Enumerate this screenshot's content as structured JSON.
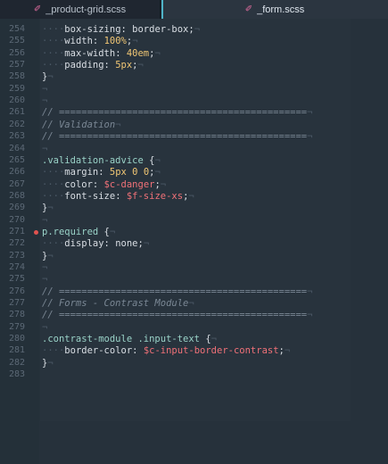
{
  "tabs": [
    {
      "label": "_product-grid.scss",
      "icon": "sass-icon",
      "active": false
    },
    {
      "label": "_form.scss",
      "icon": "sass-icon",
      "active": true
    }
  ],
  "colors": {
    "background": "#26303b",
    "gutter": "#243039",
    "comment": "#7a8794",
    "number": "#f0c674",
    "variable": "#f07178",
    "selector": "#9ad3c8",
    "breakpoint": "#e0534f",
    "active_tab_accent": "#4fb3c7"
  },
  "lines": [
    {
      "n": "254",
      "segs": [
        [
          "ws",
          "····"
        ],
        [
          "prop",
          "box-sizing: border-box;"
        ],
        [
          "ws",
          "¬"
        ]
      ]
    },
    {
      "n": "255",
      "segs": [
        [
          "ws",
          "····"
        ],
        [
          "prop",
          "width: "
        ],
        [
          "num",
          "100%"
        ],
        [
          "pn",
          ";"
        ],
        [
          "ws",
          "¬"
        ]
      ]
    },
    {
      "n": "256",
      "segs": [
        [
          "ws",
          "····"
        ],
        [
          "prop",
          "max-width: "
        ],
        [
          "num",
          "40em"
        ],
        [
          "pn",
          ";"
        ],
        [
          "ws",
          "¬"
        ]
      ]
    },
    {
      "n": "257",
      "segs": [
        [
          "ws",
          "····"
        ],
        [
          "prop",
          "padding: "
        ],
        [
          "num",
          "5px"
        ],
        [
          "pn",
          ";"
        ],
        [
          "ws",
          "¬"
        ]
      ]
    },
    {
      "n": "258",
      "segs": [
        [
          "pn",
          "}"
        ],
        [
          "ws",
          "¬"
        ]
      ]
    },
    {
      "n": "259",
      "segs": [
        [
          "ws",
          "¬"
        ]
      ]
    },
    {
      "n": "260",
      "segs": [
        [
          "ws",
          "¬"
        ]
      ]
    },
    {
      "n": "261",
      "segs": [
        [
          "cm",
          "// ============================================"
        ],
        [
          "ws",
          "¬"
        ]
      ]
    },
    {
      "n": "262",
      "segs": [
        [
          "cm",
          "// Validation"
        ],
        [
          "ws",
          "¬"
        ]
      ]
    },
    {
      "n": "263",
      "segs": [
        [
          "cm",
          "// ============================================"
        ],
        [
          "ws",
          "¬"
        ]
      ]
    },
    {
      "n": "264",
      "segs": [
        [
          "ws",
          "¬"
        ]
      ]
    },
    {
      "n": "265",
      "segs": [
        [
          "sel",
          ".validation-advice"
        ],
        [
          "pn",
          " {"
        ],
        [
          "ws",
          "¬"
        ]
      ]
    },
    {
      "n": "266",
      "segs": [
        [
          "ws",
          "····"
        ],
        [
          "prop",
          "margin: "
        ],
        [
          "num",
          "5px"
        ],
        [
          "prop",
          " "
        ],
        [
          "num",
          "0"
        ],
        [
          "prop",
          " "
        ],
        [
          "num",
          "0"
        ],
        [
          "pn",
          ";"
        ],
        [
          "ws",
          "¬"
        ]
      ]
    },
    {
      "n": "267",
      "segs": [
        [
          "ws",
          "····"
        ],
        [
          "prop",
          "color: "
        ],
        [
          "var",
          "$c-danger"
        ],
        [
          "pn",
          ";"
        ],
        [
          "ws",
          "¬"
        ]
      ]
    },
    {
      "n": "268",
      "segs": [
        [
          "ws",
          "····"
        ],
        [
          "prop",
          "font-size: "
        ],
        [
          "var",
          "$f-size-xs"
        ],
        [
          "pn",
          ";"
        ],
        [
          "ws",
          "¬"
        ]
      ]
    },
    {
      "n": "269",
      "segs": [
        [
          "pn",
          "}"
        ],
        [
          "ws",
          "¬"
        ]
      ]
    },
    {
      "n": "270",
      "segs": [
        [
          "ws",
          "¬"
        ]
      ]
    },
    {
      "n": "271",
      "breakpoint": true,
      "segs": [
        [
          "sel",
          "p.required"
        ],
        [
          "pn",
          " {"
        ],
        [
          "ws",
          "¬"
        ]
      ]
    },
    {
      "n": "272",
      "segs": [
        [
          "ws",
          "····"
        ],
        [
          "prop",
          "display: none;"
        ],
        [
          "ws",
          "¬"
        ]
      ]
    },
    {
      "n": "273",
      "segs": [
        [
          "pn",
          "}"
        ],
        [
          "ws",
          "¬"
        ]
      ]
    },
    {
      "n": "274",
      "segs": [
        [
          "ws",
          "¬"
        ]
      ]
    },
    {
      "n": "275",
      "segs": [
        [
          "ws",
          "¬"
        ]
      ]
    },
    {
      "n": "276",
      "segs": [
        [
          "cm",
          "// ============================================"
        ],
        [
          "ws",
          "¬"
        ]
      ]
    },
    {
      "n": "277",
      "segs": [
        [
          "cm",
          "// Forms - Contrast Module"
        ],
        [
          "ws",
          "¬"
        ]
      ]
    },
    {
      "n": "278",
      "segs": [
        [
          "cm",
          "// ============================================"
        ],
        [
          "ws",
          "¬"
        ]
      ]
    },
    {
      "n": "279",
      "segs": [
        [
          "ws",
          "¬"
        ]
      ]
    },
    {
      "n": "280",
      "segs": [
        [
          "sel",
          ".contrast-module .input-text"
        ],
        [
          "pn",
          " {"
        ],
        [
          "ws",
          "¬"
        ]
      ]
    },
    {
      "n": "281",
      "segs": [
        [
          "ws",
          "····"
        ],
        [
          "prop",
          "border-color: "
        ],
        [
          "var",
          "$c-input-border-contrast"
        ],
        [
          "pn",
          ";"
        ],
        [
          "ws",
          "¬"
        ]
      ]
    },
    {
      "n": "282",
      "segs": [
        [
          "pn",
          "}"
        ],
        [
          "ws",
          "¬"
        ]
      ]
    },
    {
      "n": "283",
      "segs": []
    }
  ]
}
